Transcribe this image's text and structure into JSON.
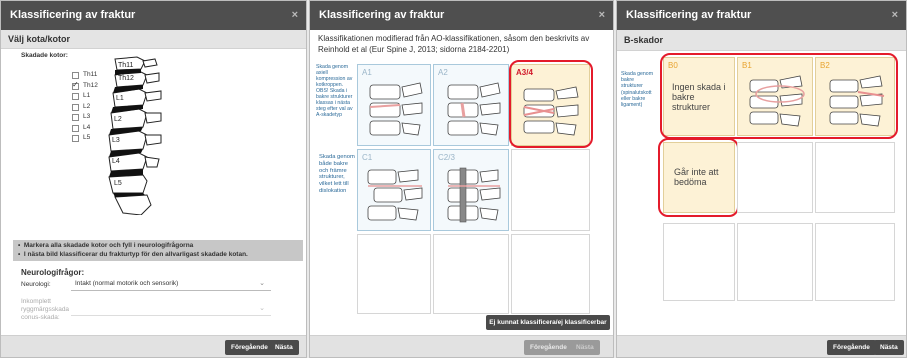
{
  "panel1": {
    "title": "Klassificering av fraktur",
    "close_glyph": "×",
    "section_title": "Välj kota/kotor",
    "injured_label": "Skadade kotor:",
    "vertebrae": [
      {
        "label": "Th11",
        "checked": false
      },
      {
        "label": "Th12",
        "checked": true
      },
      {
        "label": "L1",
        "checked": false
      },
      {
        "label": "L2",
        "checked": false
      },
      {
        "label": "L3",
        "checked": false
      },
      {
        "label": "L4",
        "checked": false
      },
      {
        "label": "L5",
        "checked": false
      }
    ],
    "diagram_labels": [
      "Th11",
      "Th12",
      "L1",
      "L2",
      "L3",
      "L4",
      "L5"
    ],
    "instructions": [
      "Markera alla skadade kotor och fyll i neurologifrågorna",
      "I nästa bild klassificerar du frakturtyp för den allvarligast skadade kotan."
    ],
    "neuro_title": "Neurologifrågor:",
    "neuro_label": "Neurologi:",
    "neuro_value": "Intakt (normal motorik och sensorik)",
    "incomplete_label_1": "Inkomplett",
    "incomplete_label_2": "ryggmärgsskada",
    "incomplete_label_3": "conus-skada:",
    "incomplete_value": "",
    "prev_label": "Föregående",
    "next_label": "Nästa"
  },
  "panel2": {
    "title": "Klassificering av fraktur",
    "close_glyph": "×",
    "intro": "Klassifikationen modifierad från AO-klassifikationen, såsom den beskrivits av Reinhold et al (Eur Spine J, 2013; sidorna 2184-2201)",
    "row1_desc": "Skada genom axiell kompression av kotkroppen. OBS! Skada i bakre strukturer klassas i nästa steg efter val av A-skadetyp",
    "row2_desc": "Skada genom både bakre och främre strukturer, vilket lett till dislokation",
    "tiles_row1": [
      "A1",
      "A2",
      "A3/4"
    ],
    "tiles_row2": [
      "C1",
      "C2/3"
    ],
    "unclassifiable_label": "Ej kunnat klassificera/ej klassificerbar",
    "prev_label": "Föregående",
    "next_label": "Nästa"
  },
  "panel3": {
    "title": "Klassificering av fraktur",
    "close_glyph": "×",
    "section_title": "B-skador",
    "row1_desc": "Skada genom bakre strukturer (spinalutskott eller bakre ligament)",
    "tiles": [
      "B0",
      "B1",
      "B2"
    ],
    "b0_text": "Ingen skada i bakre strukturer",
    "cannot_assess": "Går inte att bedöma",
    "prev_label": "Föregående",
    "next_label": "Nästa"
  }
}
